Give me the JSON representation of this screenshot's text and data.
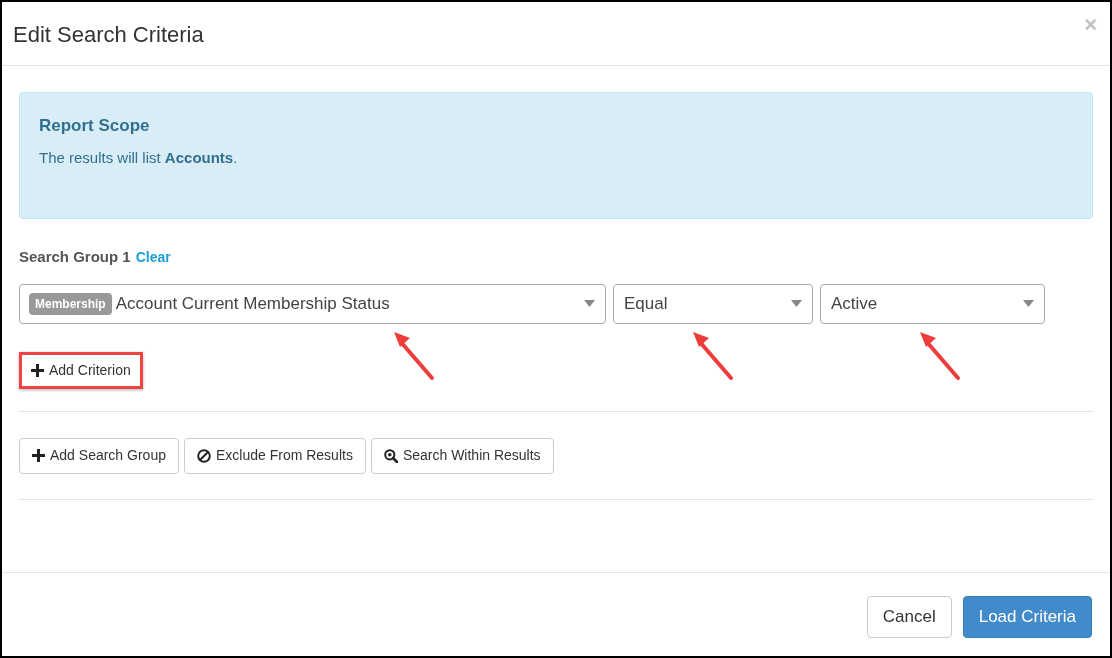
{
  "window": {
    "title": "Edit Search Criteria",
    "close": "×"
  },
  "report_scope": {
    "title": "Report Scope",
    "text": "The results will list **Accounts**."
  },
  "search_group": {
    "label": "Search Group 1",
    "clear_link": "Clear",
    "fields": [
      {
        "tag": "Membership",
        "value": "Account Current Membership Status"
      },
      {
        "value": "Equal"
      },
      {
        "value": "Active"
      }
    ],
    "add_criterion": "Add Criterion"
  },
  "group_actions": [
    {
      "kind": "plus",
      "label": "Add Search Group"
    },
    {
      "kind": "ban",
      "label": "Exclude From Results"
    },
    {
      "kind": "search",
      "label": "Search Within Results"
    }
  ],
  "footer_buttons": [
    {
      "kind": "default",
      "label": "Cancel"
    },
    {
      "kind": "primary",
      "label": "Load Criteria"
    }
  ]
}
